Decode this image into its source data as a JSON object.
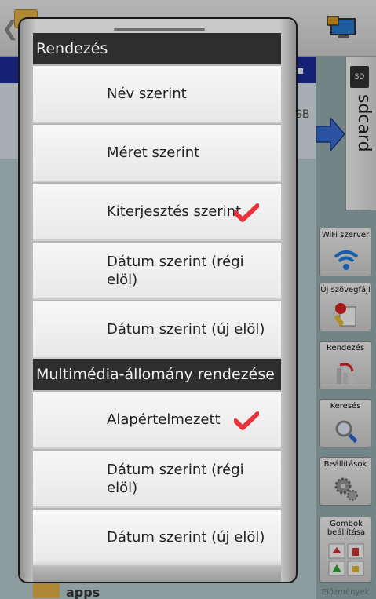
{
  "background": {
    "storage_tab": "sdcard",
    "size_suffix": "GB",
    "list_folder": "apps",
    "side_buttons": [
      {
        "label": "WiFi szerver",
        "icon": "wifi-icon"
      },
      {
        "label": "Új szövegfájl",
        "icon": "new-file-icon"
      },
      {
        "label": "Rendezés",
        "icon": "sort-icon"
      },
      {
        "label": "Keresés",
        "icon": "search-icon"
      },
      {
        "label": "Beállítások",
        "icon": "gear-icon"
      },
      {
        "label": "Gombok beállítása",
        "icon": "buttons-config-icon"
      }
    ],
    "history_label": "Előzmények"
  },
  "dialog": {
    "sections": [
      {
        "title": "Rendezés",
        "items": [
          {
            "label": "Név szerint",
            "checked": false
          },
          {
            "label": "Méret szerint",
            "checked": false
          },
          {
            "label": "Kiterjesztés szerint",
            "checked": true
          },
          {
            "label": "Dátum szerint (régi elöl)",
            "checked": false
          },
          {
            "label": "Dátum szerint (új elöl)",
            "checked": false
          }
        ]
      },
      {
        "title": "Multimédia-állomány rendezése",
        "items": [
          {
            "label": "Alapértelmezett",
            "checked": true
          },
          {
            "label": "Dátum szerint (régi elöl)",
            "checked": false
          },
          {
            "label": "Dátum szerint (új elöl)",
            "checked": false
          }
        ]
      }
    ]
  },
  "colors": {
    "accent_blue": "#1c2c9c",
    "check_red": "#e8323c",
    "section_bg": "#2e2e2e"
  }
}
